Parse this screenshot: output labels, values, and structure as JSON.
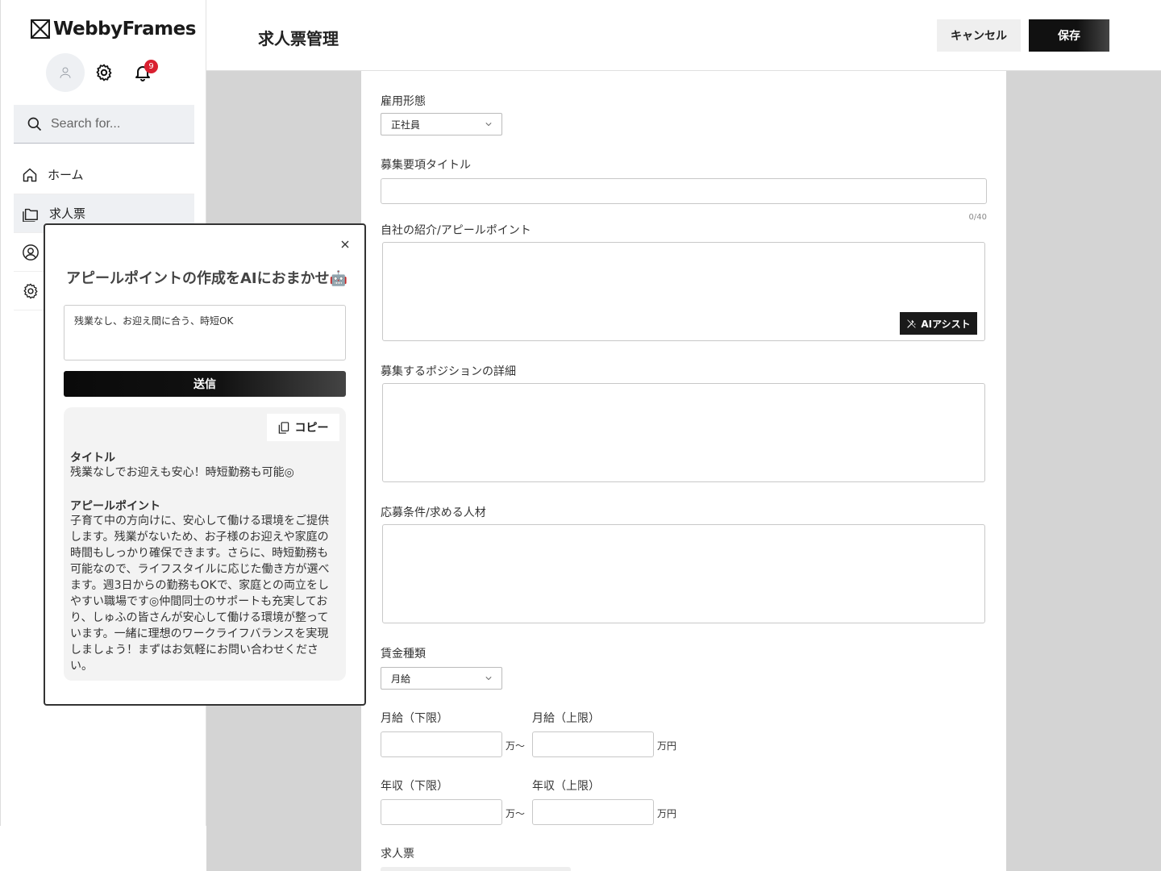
{
  "app": {
    "logo_text": "WebbyFrames",
    "notification_count": "9",
    "search_placeholder": "Search for..."
  },
  "sidebar": {
    "items": [
      {
        "label": "ホーム",
        "icon": "home-icon"
      },
      {
        "label": "求人票",
        "icon": "folder-icon"
      },
      {
        "label": "",
        "icon": "user-circle-icon"
      },
      {
        "label": "",
        "icon": "gear-icon"
      }
    ]
  },
  "header": {
    "title": "求人票管理",
    "cancel_label": "キャンセル",
    "save_label": "保存"
  },
  "form": {
    "employment_type": {
      "label": "雇用形態",
      "value": "正社員"
    },
    "recruit_title": {
      "label": "募集要項タイトル",
      "counter": "0/40"
    },
    "appeal": {
      "label": "自社の紹介/アピールポイント",
      "ai_button": "AIアシスト"
    },
    "position_detail": {
      "label": "募集するポジションの詳細"
    },
    "requirements": {
      "label": "応募条件/求める人材"
    },
    "wage_type": {
      "label": "賃金種類",
      "value": "月給"
    },
    "monthly_min": {
      "label": "月給（下限）",
      "unit": "万〜"
    },
    "monthly_max": {
      "label": "月給（上限）",
      "unit": "万円"
    },
    "annual_min": {
      "label": "年収（下限）",
      "unit": "万〜"
    },
    "annual_max": {
      "label": "年収（上限）",
      "unit": "万円"
    },
    "job_sheet": {
      "label": "求人票"
    }
  },
  "modal": {
    "title": "アピールポイントの作成をAIにおまかせ🤖",
    "input_value": "残業なし、お迎え間に合う、時短OK",
    "send_label": "送信",
    "copy_label": "コピー",
    "result_title_heading": "タイトル",
    "result_title_text": "残業なしでお迎えも安心！時短勤務も可能◎",
    "result_appeal_heading": "アピールポイント",
    "result_appeal_text": "子育て中の方向けに、安心して働ける環境をご提供します。残業がないため、お子様のお迎えや家庭の時間もしっかり確保できます。さらに、時短勤務も可能なので、ライフスタイルに応じた働き方が選べます。週3日からの勤務もOKで、家庭との両立をしやすい職場です◎仲間同士のサポートも充実しており、しゅふの皆さんが安心して働ける環境が整っています。一緒に理想のワークライフバランスを実現しましょう！まずはお気軽にお問い合わせください。"
  }
}
